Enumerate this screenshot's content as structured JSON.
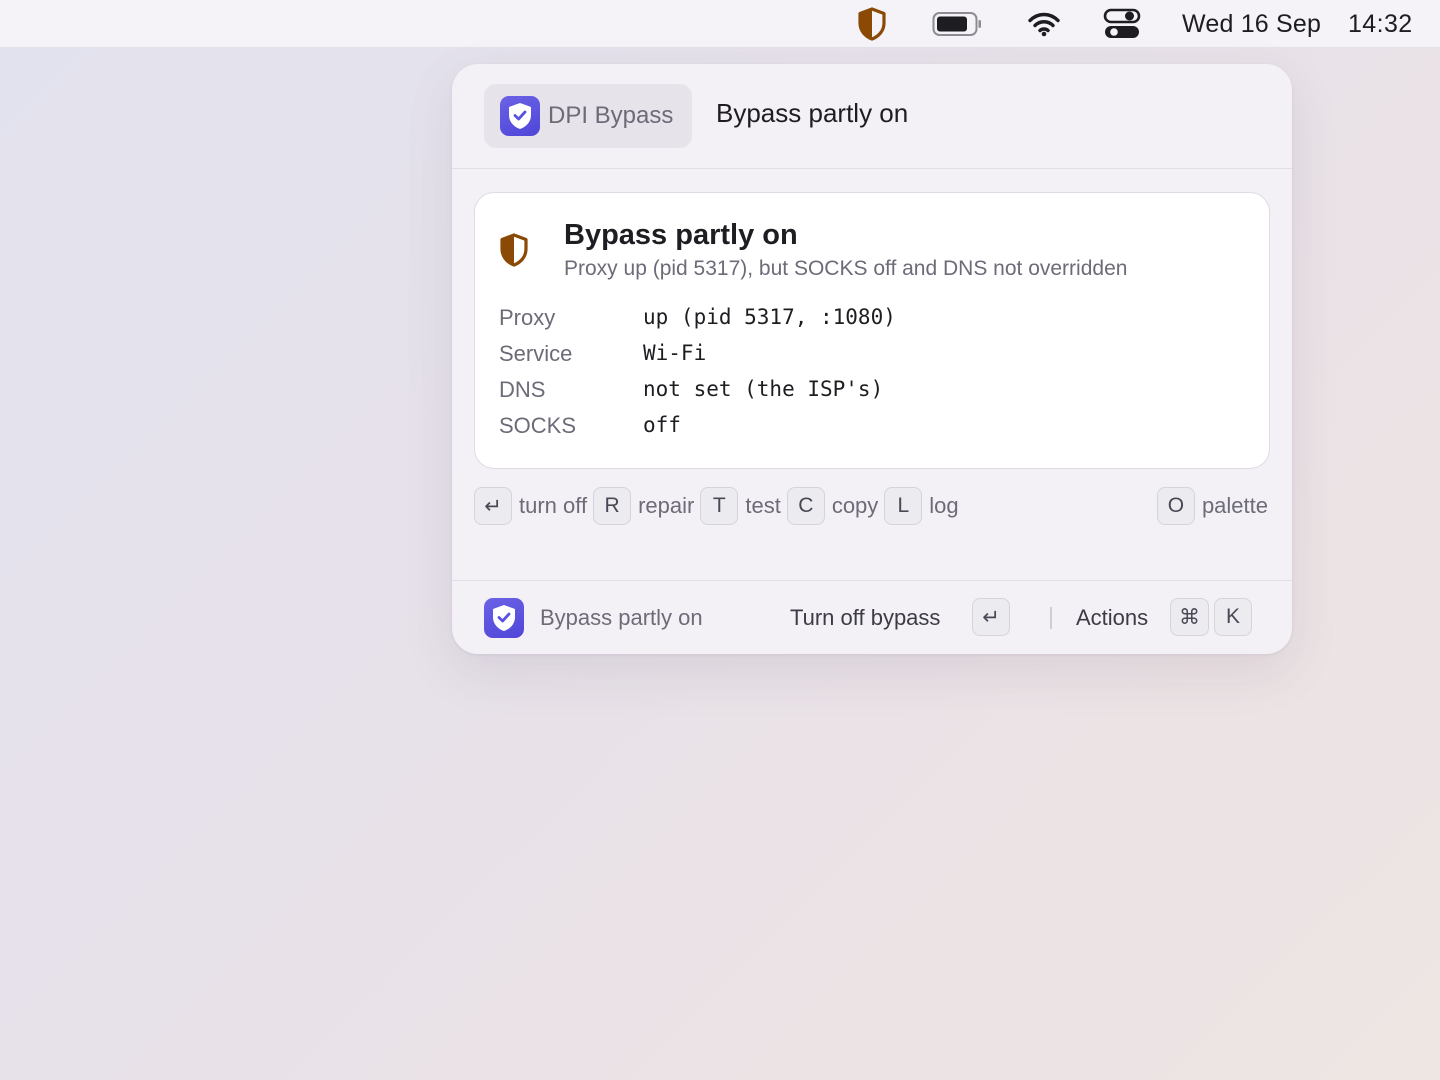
{
  "menubar": {
    "status_icon": "shield-half-icon",
    "battery_icon": "battery-icon",
    "wifi_icon": "wifi-icon",
    "control_center_icon": "control-center-icon",
    "date": "Wed 16 Sep",
    "time": "14:32",
    "status_color": "#8a4a05"
  },
  "panel": {
    "app": {
      "name": "DPI Bypass",
      "icon": "shield-check-icon",
      "accent": "#5a52e0"
    },
    "header_title": "Bypass partly on",
    "card": {
      "icon": "shield-half-icon",
      "title": "Bypass partly on",
      "subtitle": "Proxy up (pid 5317), but SOCKS off and DNS not overridden",
      "rows": [
        {
          "key": "Proxy",
          "value": "up (pid 5317, :1080)"
        },
        {
          "key": "Service",
          "value": "Wi‑Fi"
        },
        {
          "key": "DNS",
          "value": "not set (the ISP's)"
        },
        {
          "key": "SOCKS",
          "value": "off"
        }
      ]
    },
    "shortcuts": [
      {
        "key": "↵",
        "label": "turn off"
      },
      {
        "key": "R",
        "label": "repair"
      },
      {
        "key": "T",
        "label": "test"
      },
      {
        "key": "C",
        "label": "copy"
      },
      {
        "key": "L",
        "label": "log"
      }
    ],
    "shortcut_right": {
      "key": "O",
      "label": "palette"
    },
    "footer": {
      "status": "Bypass partly on",
      "primary_action": "Turn off bypass",
      "primary_key": "↵",
      "actions_label": "Actions",
      "actions_keys": [
        "⌘",
        "K"
      ]
    }
  }
}
